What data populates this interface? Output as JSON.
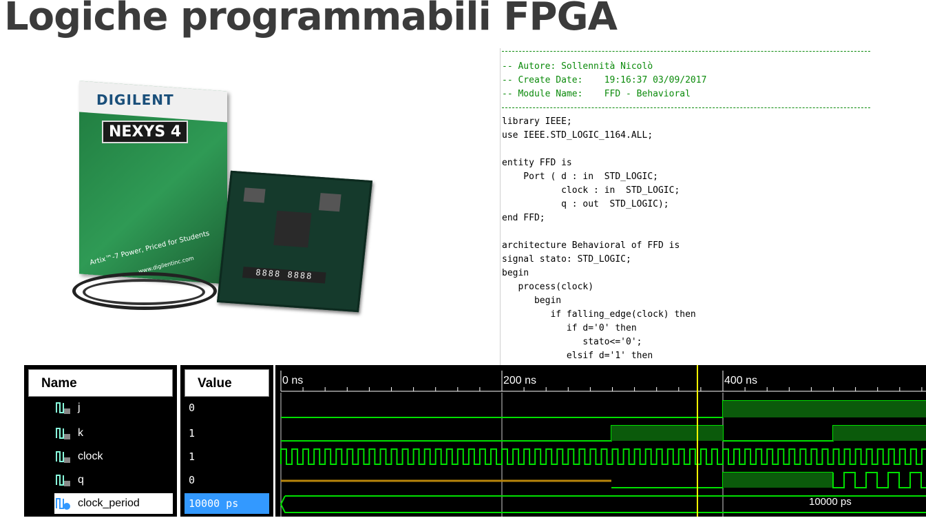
{
  "slide": {
    "title": "Logiche programmabili FPGA"
  },
  "photo": {
    "brand": "DIGILENT",
    "model": "NEXYS 4",
    "tagline": "Artix™-7 Power, Priced for Students",
    "website": "www.digilentinc.com",
    "display": "8888 8888"
  },
  "code": {
    "lines": [
      "-- Autore: Sollennità Nicolò",
      "-- Create Date:    19:16:37 03/09/2017",
      "-- Module Name:    FFD - Behavioral",
      "library IEEE;",
      "use IEEE.STD_LOGIC_1164.ALL;",
      "entity FFD is",
      "    Port ( d : in  STD_LOGIC;",
      "           clock : in  STD_LOGIC;",
      "           q : out  STD_LOGIC);",
      "end FFD;",
      "architecture Behavioral of FFD is",
      "signal stato: STD_LOGIC;",
      "begin",
      "   process(clock)",
      "      begin",
      "         if falling_edge(clock) then",
      "            if d='0' then",
      "               stato<='0';",
      "            elsif d='1' then"
    ]
  },
  "simulation": {
    "name_header": "Name",
    "value_header": "Value",
    "time_labels": [
      "0 ns",
      "200 ns",
      "400 ns"
    ],
    "signals": [
      {
        "name": "j",
        "value": "0"
      },
      {
        "name": "k",
        "value": "1"
      },
      {
        "name": "clock",
        "value": "1"
      },
      {
        "name": "q",
        "value": "0"
      },
      {
        "name": "clock_period",
        "value": "10000 ps"
      }
    ],
    "bus_value_label": "10000 ps",
    "colors": {
      "waveform": "#00e000",
      "cursor": "#ffff00",
      "undefined": "#b8860b",
      "selected": "#3399ff"
    }
  }
}
